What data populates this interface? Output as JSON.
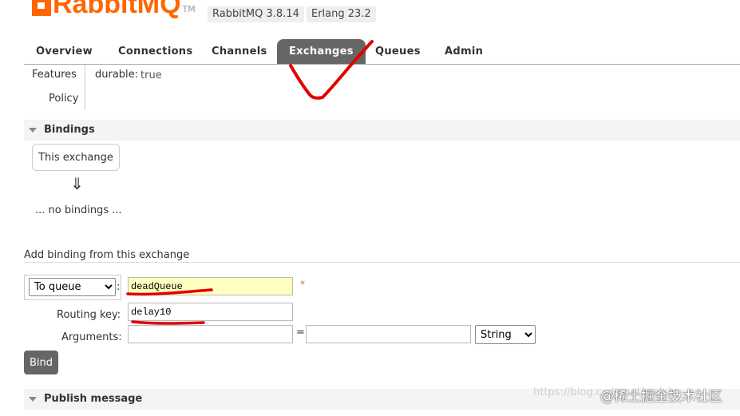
{
  "header": {
    "logo_text": "RabbitMQ",
    "logo_tm": "TM",
    "version_label": "RabbitMQ 3.8.14",
    "erlang_label": "Erlang 23.2"
  },
  "tabs": [
    {
      "label": "Overview"
    },
    {
      "label": "Connections"
    },
    {
      "label": "Channels"
    },
    {
      "label": "Exchanges",
      "active": true
    },
    {
      "label": "Queues"
    },
    {
      "label": "Admin"
    }
  ],
  "features": {
    "features_label": "Features",
    "durable_key": "durable:",
    "durable_value": "true",
    "policy_label": "Policy"
  },
  "bindings": {
    "title": "Bindings",
    "this_exchange": "This exchange",
    "arrow": "⇓",
    "no_bindings": "... no bindings ..."
  },
  "add_binding": {
    "title": "Add binding from this exchange",
    "destination_type": "To queue",
    "colon": ":",
    "destination_value": "deadQueue",
    "required_mark": "*",
    "routing_key_label": "Routing key:",
    "routing_key_value": "delay10",
    "arguments_label": "Arguments:",
    "arguments_key": "",
    "equals": "=",
    "arguments_value": "",
    "arg_type": "String",
    "bind_button": "Bind"
  },
  "publish": {
    "title": "Publish message"
  },
  "watermark": {
    "url": "https://blog.csdn.net/weixin_...",
    "site": "@稀土掘金技术社区"
  },
  "annotation_color": "#e00000"
}
